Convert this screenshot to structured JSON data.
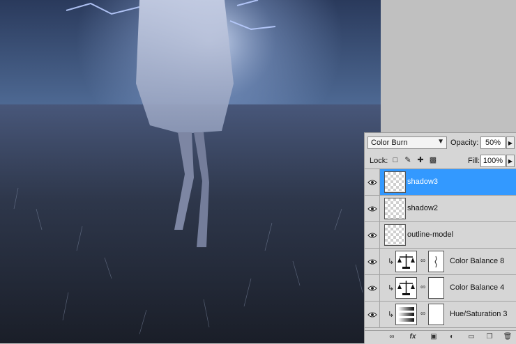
{
  "panel": {
    "blend_mode": "Color Burn",
    "opacity_label": "Opacity:",
    "opacity_value": "50%",
    "lock_label": "Lock:",
    "fill_label": "Fill:",
    "fill_value": "100%"
  },
  "layers": [
    {
      "name": "shadow3",
      "selected": true,
      "type": "pixel"
    },
    {
      "name": "shadow2",
      "selected": false,
      "type": "pixel"
    },
    {
      "name": "outline-model",
      "selected": false,
      "type": "pixel"
    },
    {
      "name": "Color Balance 8",
      "selected": false,
      "type": "adjustment",
      "icon": "balance-scale-icon",
      "clipped": true
    },
    {
      "name": "Color Balance 4",
      "selected": false,
      "type": "adjustment",
      "icon": "balance-scale-icon",
      "clipped": true
    },
    {
      "name": "Hue/Saturation 3",
      "selected": false,
      "type": "adjustment",
      "icon": "hue-saturation-icon",
      "clipped": true
    }
  ],
  "colors": {
    "selection": "#3399ff",
    "panel_bg": "#d6d6d6"
  }
}
